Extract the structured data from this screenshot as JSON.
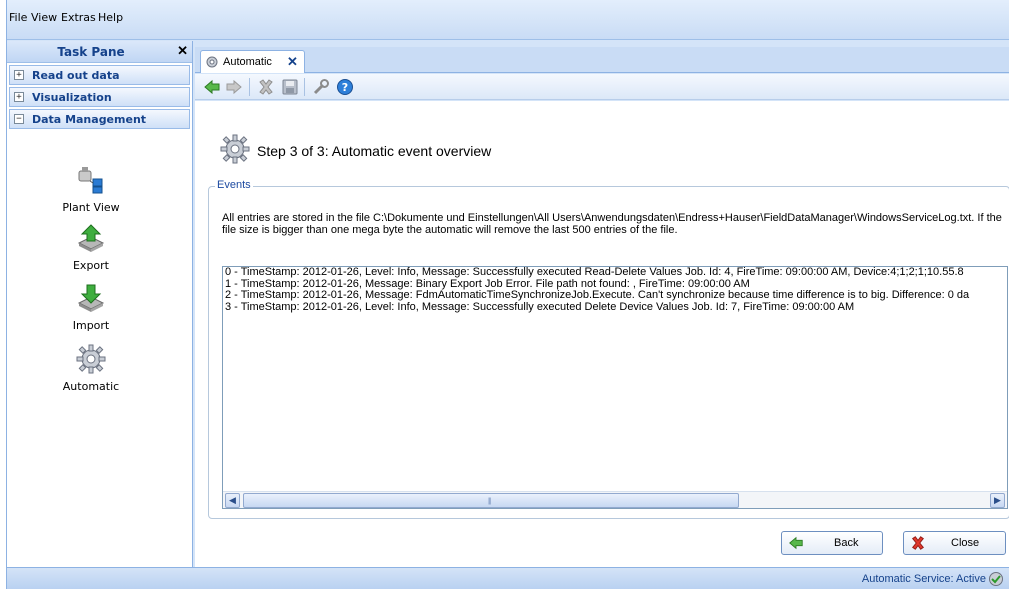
{
  "menu": {
    "file": "File",
    "view": "View",
    "extras": "Extras",
    "help": "Help"
  },
  "task_pane": {
    "title": "Task Pane",
    "close": "✕",
    "groups": [
      {
        "label": "Read out data",
        "state": "+"
      },
      {
        "label": "Visualization",
        "state": "+"
      },
      {
        "label": "Data Management",
        "state": "−"
      }
    ],
    "items": [
      {
        "label": "Plant View",
        "icon": "plant-view-icon"
      },
      {
        "label": "Export",
        "icon": "export-icon"
      },
      {
        "label": "Import",
        "icon": "import-icon"
      },
      {
        "label": "Automatic",
        "icon": "gear-icon"
      }
    ]
  },
  "tab": {
    "label": "Automatic",
    "close": "✕"
  },
  "toolbar": {
    "icons": [
      "back-arrow-icon",
      "forward-arrow-icon",
      "delete-icon",
      "save-icon",
      "tools-icon",
      "help-icon"
    ]
  },
  "main": {
    "step_title": "Step 3 of 3: Automatic event overview",
    "events_legend": "Events",
    "events_desc": "All entries are stored in the file C:\\Dokumente und Einstellungen\\All Users\\Anwendungsdaten\\Endress+Hauser\\FieldDataManager\\WindowsServiceLog.txt. If the file size is bigger than one mega byte the automatic will remove the last 500 entries of the file.",
    "log": [
      "0 - TimeStamp: 2012-01-26, Level: Info, Message: Successfully executed Read-Delete Values Job. Id: 4, FireTime: 09:00:00 AM, Device:4;1;2;1;10.55.8",
      "1 - TimeStamp: 2012-01-26, Message: Binary Export Job Error. File path not found: , FireTime: 09:00:00 AM",
      "2 - TimeStamp: 2012-01-26, Message: FdmAutomaticTimeSynchronizeJob.Execute. Can't synchronize because time difference is to big. Difference: 0 da",
      "3 - TimeStamp: 2012-01-26, Level: Info, Message: Successfully executed Delete Device Values Job. Id: 7, FireTime: 09:00:00 AM"
    ],
    "back_label": "Back",
    "close_label": "Close"
  },
  "status": {
    "text": "Automatic Service: Active"
  },
  "colors": {
    "frame": "#d4e4f8",
    "header_text": "#15428b",
    "accent_border": "#8db2e3"
  }
}
